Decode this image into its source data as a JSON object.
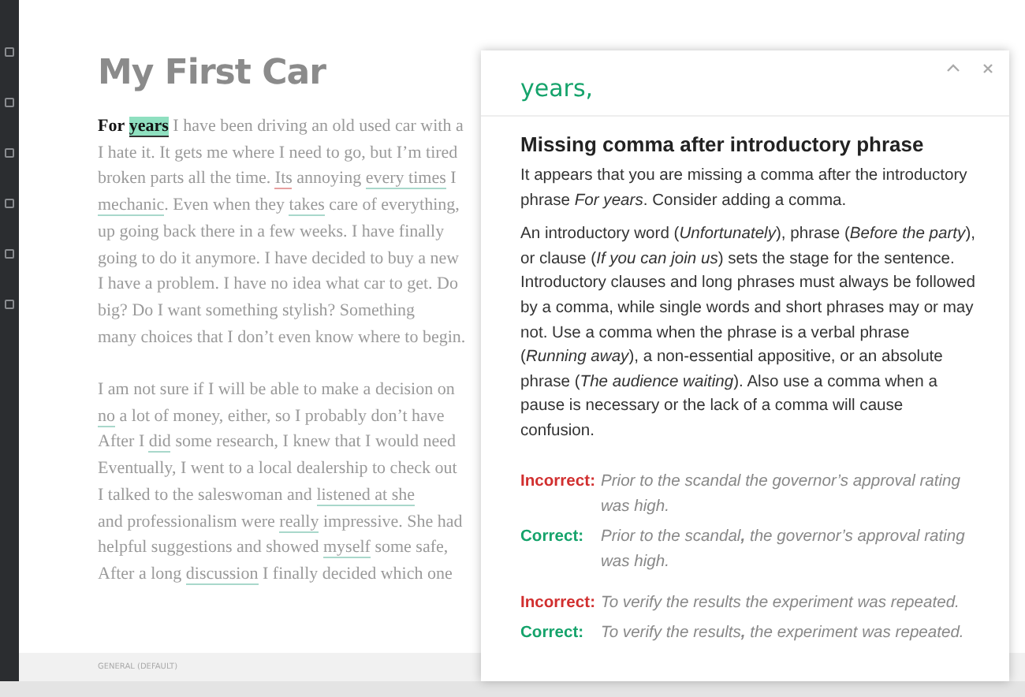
{
  "document": {
    "title": "My First Car",
    "paragraphs": [
      [
        [
          {
            "kind": "bold",
            "text": "For"
          },
          {
            "kind": "highlight",
            "text": "years"
          },
          {
            "kind": "plain",
            "text": " I have been driving an old used car with a"
          }
        ],
        [
          {
            "kind": "plain",
            "text": "I hate it. It gets me where I need to go, but I’m tired"
          }
        ],
        [
          {
            "kind": "plain",
            "text": "broken parts all the time. "
          },
          {
            "kind": "error",
            "text": "Its"
          },
          {
            "kind": "plain",
            "text": " annoying "
          },
          {
            "kind": "flagged",
            "text": "every times"
          },
          {
            "kind": "plain",
            "text": " I"
          }
        ],
        [
          {
            "kind": "flagged",
            "text": "mechanic"
          },
          {
            "kind": "plain",
            "text": ". Even when they "
          },
          {
            "kind": "flagged",
            "text": "takes"
          },
          {
            "kind": "plain",
            "text": " care of everything,"
          }
        ],
        [
          {
            "kind": "plain",
            "text": "up going back there in a few weeks. I have finally"
          }
        ],
        [
          {
            "kind": "plain",
            "text": "going to do it anymore. I have decided to buy a new"
          }
        ],
        [
          {
            "kind": "plain",
            "text": "I have a problem. I have no idea what car to get. Do"
          }
        ],
        [
          {
            "kind": "plain",
            "text": "big? Do I want something stylish? Something"
          }
        ],
        [
          {
            "kind": "plain",
            "text": "many choices that I don’t even know where to begin."
          }
        ]
      ],
      [
        [
          {
            "kind": "plain",
            "text": "I am not sure if I will be able to make a decision on"
          }
        ],
        [
          {
            "kind": "flagged",
            "text": "no"
          },
          {
            "kind": "plain",
            "text": " a lot of money, either, so I probably don’t have"
          }
        ],
        [
          {
            "kind": "plain",
            "text": "After I "
          },
          {
            "kind": "flagged",
            "text": "did"
          },
          {
            "kind": "plain",
            "text": " some research, I knew that I would need"
          }
        ],
        [
          {
            "kind": "plain",
            "text": "Eventually, I went to a local dealership to check out"
          }
        ],
        [
          {
            "kind": "plain",
            "text": "I talked to the saleswoman and "
          },
          {
            "kind": "flagged",
            "text": "listened at she"
          }
        ],
        [
          {
            "kind": "plain",
            "text": "and professionalism were "
          },
          {
            "kind": "flagged",
            "text": "really"
          },
          {
            "kind": "plain",
            "text": " impressive. She had"
          }
        ],
        [
          {
            "kind": "plain",
            "text": "helpful suggestions and showed "
          },
          {
            "kind": "flagged",
            "text": "myself"
          },
          {
            "kind": "plain",
            "text": " some safe,"
          }
        ],
        [
          {
            "kind": "plain",
            "text": "After a long "
          },
          {
            "kind": "flagged",
            "text": "discussion"
          },
          {
            "kind": "plain",
            "text": " I finally decided which one"
          }
        ]
      ]
    ]
  },
  "status_bar": {
    "label": "GENERAL (DEFAULT)"
  },
  "suggestion": {
    "replacement": "years,",
    "title": "Missing comma after introductory phrase",
    "paragraphs": [
      "It appears that you are missing a comma after the introductory phrase *For years*. Consider adding a comma.",
      "An introductory word (*Unfortunately*), phrase (*Before the party*), or clause (*If you can join us*) sets the stage for the sentence. Introductory clauses and long phrases must always be followed by a comma, while single words and short phrases may or may not. Use a comma when the phrase is a verbal phrase (*Running away*), a non-essential appositive, or an absolute phrase (*The audience waiting*). Also use a comma when a pause is necessary or the lack of a comma will cause confusion."
    ],
    "examples": [
      [
        {
          "kind": "incorrect",
          "label": "Incorrect:",
          "text": "Prior to the scandal the governor’s approval rating was high."
        },
        {
          "kind": "correct",
          "label": "Correct:",
          "text": "Prior to the scandal**,** the governor’s approval rating was high."
        }
      ],
      [
        {
          "kind": "incorrect",
          "label": "Incorrect:",
          "text": "To verify the results the experiment was repeated."
        },
        {
          "kind": "correct",
          "label": "Correct:",
          "text": "To verify the results**,** the experiment was repeated."
        }
      ]
    ]
  }
}
